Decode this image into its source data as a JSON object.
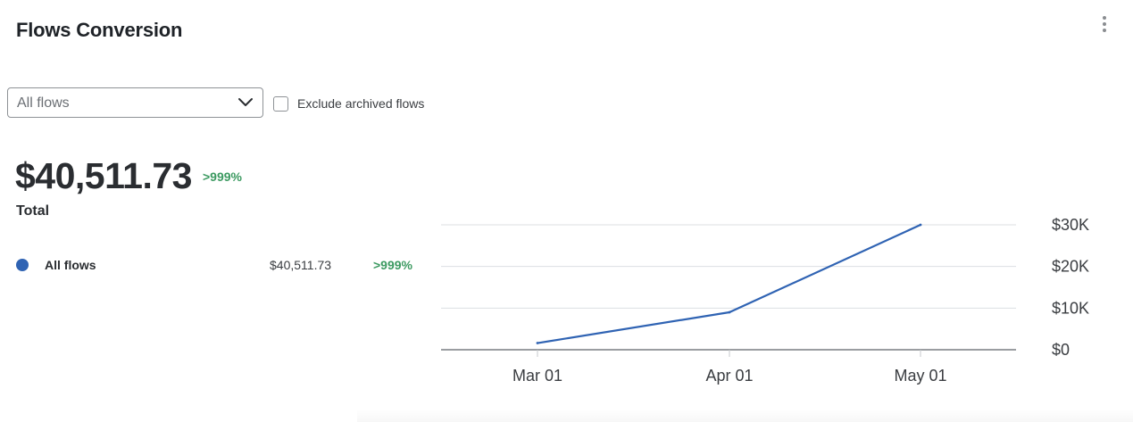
{
  "header": {
    "title": "Flows Conversion",
    "menu_icon": "more-vertical-icon"
  },
  "filters": {
    "flow_select_value": "All flows",
    "flow_select_icon": "chevron-down-icon",
    "exclude_archived_label": "Exclude archived flows",
    "exclude_archived_checked": false
  },
  "summary": {
    "total_value": "$40,511.73",
    "total_change": ">999%",
    "total_label": "Total"
  },
  "legend": [
    {
      "name": "All flows",
      "value": "$40,511.73",
      "change": ">999%",
      "color": "#2f63b3"
    }
  ],
  "colors": {
    "accent": "#2f63b3",
    "positive": "#3c9a61",
    "grid": "#dcdfe2",
    "axis": "#9a9da1"
  },
  "chart_data": {
    "type": "line",
    "categories": [
      "Mar 01",
      "Apr 01",
      "May 01"
    ],
    "x_ticks": [
      "Mar 01",
      "Apr 01",
      "May 01"
    ],
    "y_ticks": [
      "$0",
      "$10K",
      "$20K",
      "$30K"
    ],
    "y_tick_values": [
      0,
      10000,
      20000,
      30000
    ],
    "ylim": [
      0,
      30000
    ],
    "grid": true,
    "y_axis_position": "right",
    "series": [
      {
        "values": [
          1600,
          9000,
          30000
        ],
        "color": "#2f63b3"
      }
    ]
  }
}
